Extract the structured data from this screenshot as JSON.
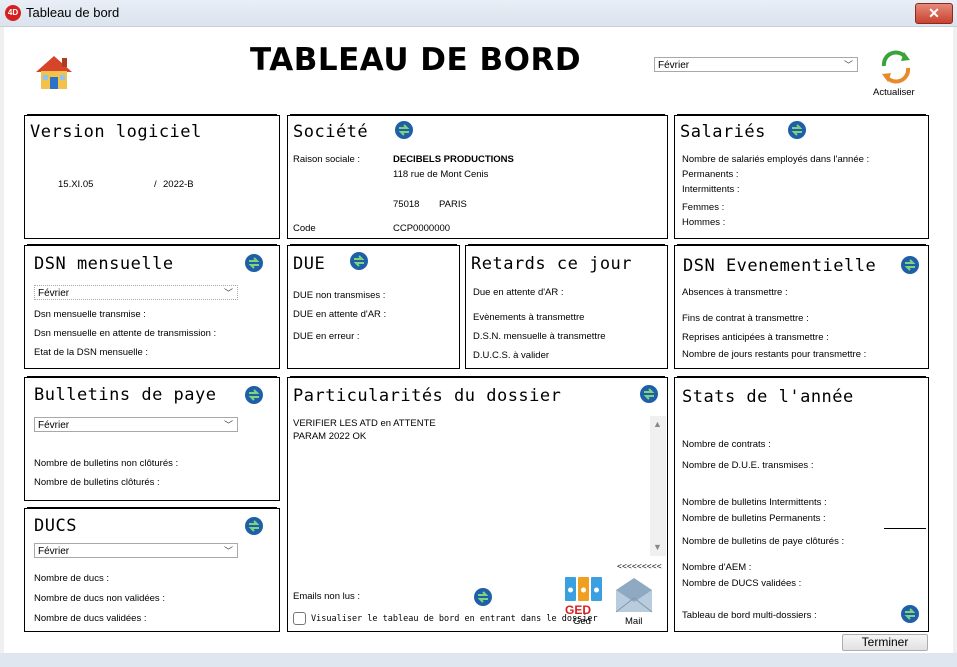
{
  "window": {
    "title": "Tableau de bord",
    "app_icon_text": "4D"
  },
  "header": {
    "title": "TABLEAU DE BORD",
    "month_select": "Février",
    "refresh_label": "Actualiser"
  },
  "version": {
    "title": "Version logiciel",
    "number": "15.XI.05",
    "separator": "/",
    "year": "2022-B"
  },
  "societe": {
    "title": "Société",
    "raison_label": "Raison sociale :",
    "company_name": "DECIBELS PRODUCTIONS",
    "address": "118 rue de Mont Cenis",
    "postcode": "75018",
    "city": "PARIS",
    "code_label": "Code",
    "code_value": "CCP0000000"
  },
  "salaries": {
    "title": "Salariés",
    "nombre": "Nombre de salariés employés dans l'année :",
    "permanents": "Permanents :",
    "intermittents": "Intermittents :",
    "femmes": "Femmes :",
    "hommes": "Hommes :"
  },
  "dsn_mensuelle": {
    "title": "DSN mensuelle",
    "select": "Février",
    "transmise": "Dsn mensuelle transmise :",
    "attente": "Dsn mensuelle en attente de transmission :",
    "etat": "Etat de la DSN mensuelle :"
  },
  "due": {
    "title": "DUE",
    "non_transmises": "DUE non transmises :",
    "attente_ar": "DUE en attente d'AR :",
    "erreur": "DUE en erreur :"
  },
  "retards": {
    "title": "Retards ce jour",
    "due_attente": "Due en attente d'AR :",
    "evenements": "Evènements à transmettre",
    "dsn_mensuelle": "D.S.N. mensuelle à transmettre",
    "ducs": "D.U.C.S. à valider"
  },
  "dsn_evenementielle": {
    "title": "DSN Evenementielle",
    "absences": "Absences à transmettre :",
    "fins_contrat": "Fins de contrat à transmettre :",
    "reprises": "Reprises anticipées à transmettre :",
    "jours_restants": "Nombre de jours restants pour transmettre :"
  },
  "bulletins": {
    "title": "Bulletins de paye",
    "select": "Février",
    "non_clotures": "Nombre de bulletins non clôturés :",
    "clotures": "Nombre de bulletins clôturés :"
  },
  "ducs": {
    "title": "DUCS",
    "select": "Février",
    "nombre": "Nombre de ducs  :",
    "non_validees": "Nombre de ducs non validées :",
    "validees": "Nombre de ducs validées :"
  },
  "particularites": {
    "title": "Particularités du dossier",
    "note_line1": "VERIFIER LES ATD en ATTENTE",
    "note_line2": "PARAM 2022 OK",
    "emails_label": "Emails non lus :",
    "checkbox_label": "Visualiser le tableau de bord en entrant dans le dossier",
    "ged_label": "Ged",
    "ged_text": "GED",
    "mail_arrows": "<<<<<<<<<",
    "mail_label": "Mail"
  },
  "stats": {
    "title": "Stats de l'année",
    "contrats": "Nombre de contrats  :",
    "due_transmises": "Nombre de D.U.E. transmises :",
    "bulletins_intermittents": "Nombre de bulletins Intermittents :",
    "bulletins_permanents": "Nombre de bulletins Permanents :",
    "bulletins_clotures": "Nombre de bulletins de paye clôturés  :",
    "aem": "Nombre d'AEM :",
    "ducs_validees": "Nombre de DUCS validées :",
    "multi_dossiers": "Tableau de bord multi-dossiers :"
  },
  "footer": {
    "terminer": "Terminer"
  },
  "colors": {
    "accent_blue": "#1f5fa8",
    "accent_green": "#3a9a3a",
    "refresh_orange": "#e8892a"
  }
}
